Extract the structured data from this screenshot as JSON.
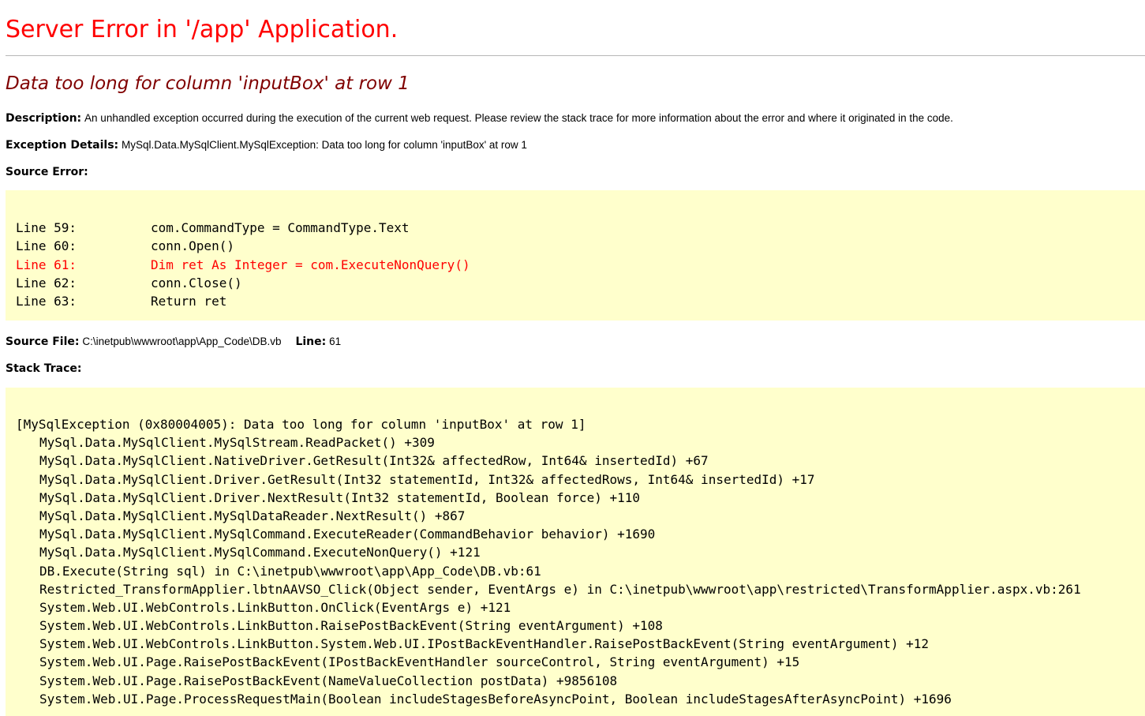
{
  "page": {
    "title": "Server Error in '/app' Application.",
    "error_message": "Data too long for column 'inputBox' at row 1"
  },
  "description": {
    "label": "Description:",
    "text": "An unhandled exception occurred during the execution of the current web request. Please review the stack trace for more information about the error and where it originated in the code."
  },
  "exception_details": {
    "label": "Exception Details:",
    "text": "MySql.Data.MySqlClient.MySqlException: Data too long for column 'inputBox' at row 1"
  },
  "source_error": {
    "label": "Source Error:",
    "lines": [
      {
        "number": "Line 59:",
        "code": "com.CommandType = CommandType.Text",
        "highlight": false
      },
      {
        "number": "Line 60:",
        "code": "conn.Open()",
        "highlight": false
      },
      {
        "number": "Line 61:",
        "code": "Dim ret As Integer = com.ExecuteNonQuery()",
        "highlight": true
      },
      {
        "number": "Line 62:",
        "code": "conn.Close()",
        "highlight": false
      },
      {
        "number": "Line 63:",
        "code": "Return ret",
        "highlight": false
      }
    ]
  },
  "source_file": {
    "label": "Source File:",
    "path": "C:\\inetpub\\wwwroot\\app\\App_Code\\DB.vb",
    "line_label": "Line:",
    "line_value": "61"
  },
  "stack_trace": {
    "label": "Stack Trace:",
    "header": "[MySqlException (0x80004005): Data too long for column 'inputBox' at row 1]",
    "frames": [
      "MySql.Data.MySqlClient.MySqlStream.ReadPacket() +309",
      "MySql.Data.MySqlClient.NativeDriver.GetResult(Int32& affectedRow, Int64& insertedId) +67",
      "MySql.Data.MySqlClient.Driver.GetResult(Int32 statementId, Int32& affectedRows, Int64& insertedId) +17",
      "MySql.Data.MySqlClient.Driver.NextResult(Int32 statementId, Boolean force) +110",
      "MySql.Data.MySqlClient.MySqlDataReader.NextResult() +867",
      "MySql.Data.MySqlClient.MySqlCommand.ExecuteReader(CommandBehavior behavior) +1690",
      "MySql.Data.MySqlClient.MySqlCommand.ExecuteNonQuery() +121",
      "DB.Execute(String sql) in C:\\inetpub\\wwwroot\\app\\App_Code\\DB.vb:61",
      "Restricted_TransformApplier.lbtnAAVSO_Click(Object sender, EventArgs e) in C:\\inetpub\\wwwroot\\app\\restricted\\TransformApplier.aspx.vb:261",
      "System.Web.UI.WebControls.LinkButton.OnClick(EventArgs e) +121",
      "System.Web.UI.WebControls.LinkButton.RaisePostBackEvent(String eventArgument) +108",
      "System.Web.UI.WebControls.LinkButton.System.Web.UI.IPostBackEventHandler.RaisePostBackEvent(String eventArgument) +12",
      "System.Web.UI.Page.RaisePostBackEvent(IPostBackEventHandler sourceControl, String eventArgument) +15",
      "System.Web.UI.Page.RaisePostBackEvent(NameValueCollection postData) +9856108",
      "System.Web.UI.Page.ProcessRequestMain(Boolean includeStagesBeforeAsyncPoint, Boolean includeStagesAfterAsyncPoint) +1696"
    ]
  },
  "colors": {
    "title": "#ff0000",
    "error_message": "#800000",
    "code_background": "#ffffcc",
    "highlight_line": "#ff0000"
  }
}
